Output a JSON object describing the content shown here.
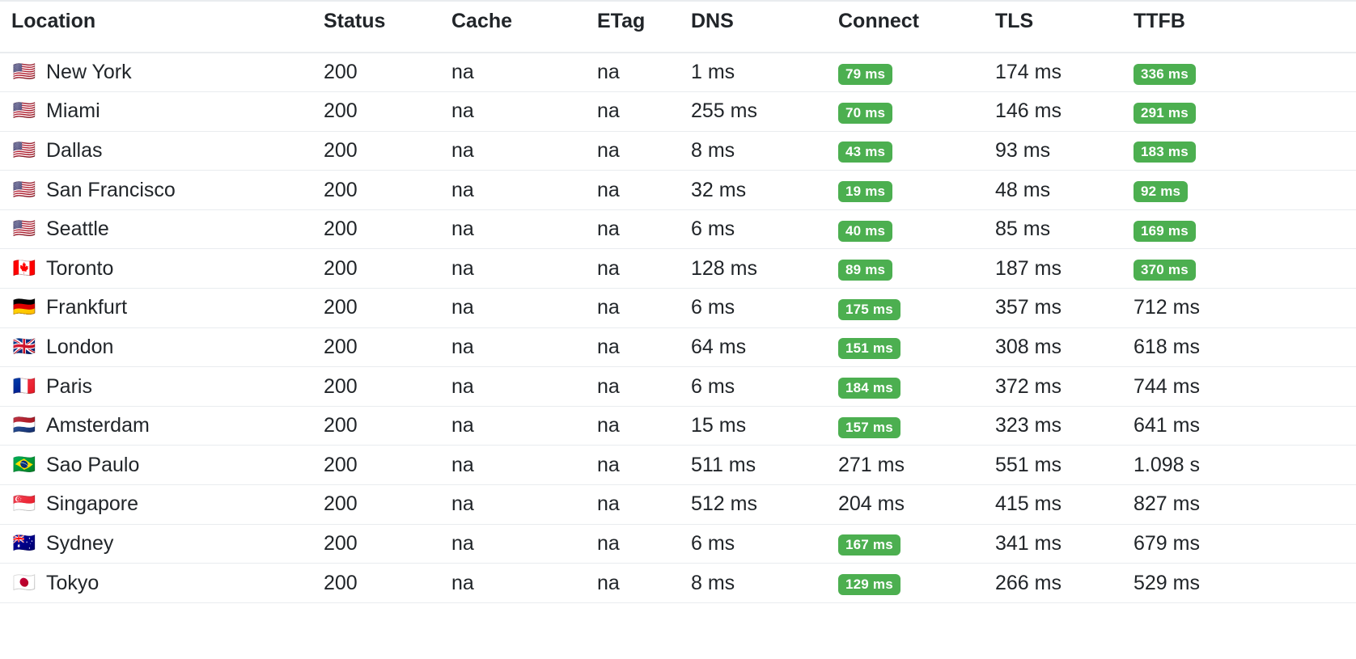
{
  "table": {
    "columns": [
      {
        "key": "location",
        "label": "Location"
      },
      {
        "key": "status",
        "label": "Status"
      },
      {
        "key": "cache",
        "label": "Cache"
      },
      {
        "key": "etag",
        "label": "ETag"
      },
      {
        "key": "dns",
        "label": "DNS"
      },
      {
        "key": "connect",
        "label": "Connect"
      },
      {
        "key": "tls",
        "label": "TLS"
      },
      {
        "key": "ttfb",
        "label": "TTFB"
      }
    ],
    "badge_color": "#4caf50",
    "badge_text_color": "#ffffff",
    "rows": [
      {
        "flag": "🇺🇸",
        "flag_name": "flag-us",
        "location": "New York",
        "status": "200",
        "cache": "na",
        "etag": "na",
        "dns": "1 ms",
        "connect": "79 ms",
        "connect_badge": true,
        "tls": "174 ms",
        "ttfb": "336 ms",
        "ttfb_badge": true
      },
      {
        "flag": "🇺🇸",
        "flag_name": "flag-us",
        "location": "Miami",
        "status": "200",
        "cache": "na",
        "etag": "na",
        "dns": "255 ms",
        "connect": "70 ms",
        "connect_badge": true,
        "tls": "146 ms",
        "ttfb": "291 ms",
        "ttfb_badge": true
      },
      {
        "flag": "🇺🇸",
        "flag_name": "flag-us",
        "location": "Dallas",
        "status": "200",
        "cache": "na",
        "etag": "na",
        "dns": "8 ms",
        "connect": "43 ms",
        "connect_badge": true,
        "tls": "93 ms",
        "ttfb": "183 ms",
        "ttfb_badge": true
      },
      {
        "flag": "🇺🇸",
        "flag_name": "flag-us",
        "location": "San Francisco",
        "status": "200",
        "cache": "na",
        "etag": "na",
        "dns": "32 ms",
        "connect": "19 ms",
        "connect_badge": true,
        "tls": "48 ms",
        "ttfb": "92 ms",
        "ttfb_badge": true
      },
      {
        "flag": "🇺🇸",
        "flag_name": "flag-us",
        "location": "Seattle",
        "status": "200",
        "cache": "na",
        "etag": "na",
        "dns": "6 ms",
        "connect": "40 ms",
        "connect_badge": true,
        "tls": "85 ms",
        "ttfb": "169 ms",
        "ttfb_badge": true
      },
      {
        "flag": "🇨🇦",
        "flag_name": "flag-ca",
        "location": "Toronto",
        "status": "200",
        "cache": "na",
        "etag": "na",
        "dns": "128 ms",
        "connect": "89 ms",
        "connect_badge": true,
        "tls": "187 ms",
        "ttfb": "370 ms",
        "ttfb_badge": true
      },
      {
        "flag": "🇩🇪",
        "flag_name": "flag-de",
        "location": "Frankfurt",
        "status": "200",
        "cache": "na",
        "etag": "na",
        "dns": "6 ms",
        "connect": "175 ms",
        "connect_badge": true,
        "tls": "357 ms",
        "ttfb": "712 ms",
        "ttfb_badge": false
      },
      {
        "flag": "🇬🇧",
        "flag_name": "flag-gb",
        "location": "London",
        "status": "200",
        "cache": "na",
        "etag": "na",
        "dns": "64 ms",
        "connect": "151 ms",
        "connect_badge": true,
        "tls": "308 ms",
        "ttfb": "618 ms",
        "ttfb_badge": false
      },
      {
        "flag": "🇫🇷",
        "flag_name": "flag-fr",
        "location": "Paris",
        "status": "200",
        "cache": "na",
        "etag": "na",
        "dns": "6 ms",
        "connect": "184 ms",
        "connect_badge": true,
        "tls": "372 ms",
        "ttfb": "744 ms",
        "ttfb_badge": false
      },
      {
        "flag": "🇳🇱",
        "flag_name": "flag-nl",
        "location": "Amsterdam",
        "status": "200",
        "cache": "na",
        "etag": "na",
        "dns": "15 ms",
        "connect": "157 ms",
        "connect_badge": true,
        "tls": "323 ms",
        "ttfb": "641 ms",
        "ttfb_badge": false
      },
      {
        "flag": "🇧🇷",
        "flag_name": "flag-br",
        "location": "Sao Paulo",
        "status": "200",
        "cache": "na",
        "etag": "na",
        "dns": "511 ms",
        "connect": "271 ms",
        "connect_badge": false,
        "tls": "551 ms",
        "ttfb": "1.098 s",
        "ttfb_badge": false
      },
      {
        "flag": "🇸🇬",
        "flag_name": "flag-sg",
        "location": "Singapore",
        "status": "200",
        "cache": "na",
        "etag": "na",
        "dns": "512 ms",
        "connect": "204 ms",
        "connect_badge": false,
        "tls": "415 ms",
        "ttfb": "827 ms",
        "ttfb_badge": false
      },
      {
        "flag": "🇦🇺",
        "flag_name": "flag-au",
        "location": "Sydney",
        "status": "200",
        "cache": "na",
        "etag": "na",
        "dns": "6 ms",
        "connect": "167 ms",
        "connect_badge": true,
        "tls": "341 ms",
        "ttfb": "679 ms",
        "ttfb_badge": false
      },
      {
        "flag": "🇯🇵",
        "flag_name": "flag-jp",
        "location": "Tokyo",
        "status": "200",
        "cache": "na",
        "etag": "na",
        "dns": "8 ms",
        "connect": "129 ms",
        "connect_badge": true,
        "tls": "266 ms",
        "ttfb": "529 ms",
        "ttfb_badge": false
      }
    ]
  }
}
